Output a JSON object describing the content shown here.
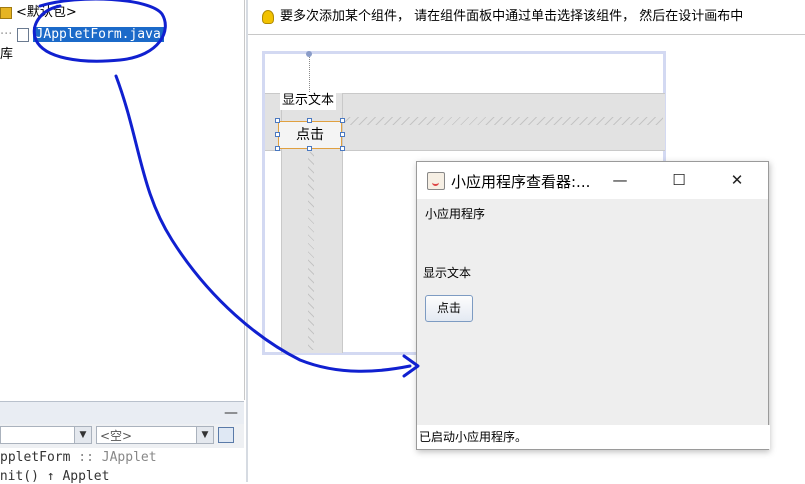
{
  "project_tree": {
    "package_label": "<默认包>",
    "file_label": "JAppletForm.java",
    "library_label_partial": "库"
  },
  "navigator": {
    "minimize_label": "—",
    "combo1_value": "",
    "combo2_value": "<空>",
    "class_line": "ppletForm :: JApplet",
    "class_line_prefix": "ppletForm ",
    "class_line_muted": ":: JApplet",
    "method_line": "init()  ↑ Applet"
  },
  "designer": {
    "hint_text": "要多次添加某个组件， 请在组件面板中通过单击选择该组件， 然后在设计画布中",
    "label_text": "显示文本",
    "button_text": "点击"
  },
  "applet_viewer": {
    "title": "小应用程序查看器:...",
    "minimize_glyph": "—",
    "maximize_glyph": "☐",
    "close_glyph": "✕",
    "applet_caption": "小应用程序",
    "label_text": "显示文本",
    "button_text": "点击",
    "status_text": "已启动小应用程序。"
  },
  "colors": {
    "selection": "#1b6ac9",
    "annotation_ink": "#1020d0",
    "canvas_border": "#d3d9f2"
  }
}
